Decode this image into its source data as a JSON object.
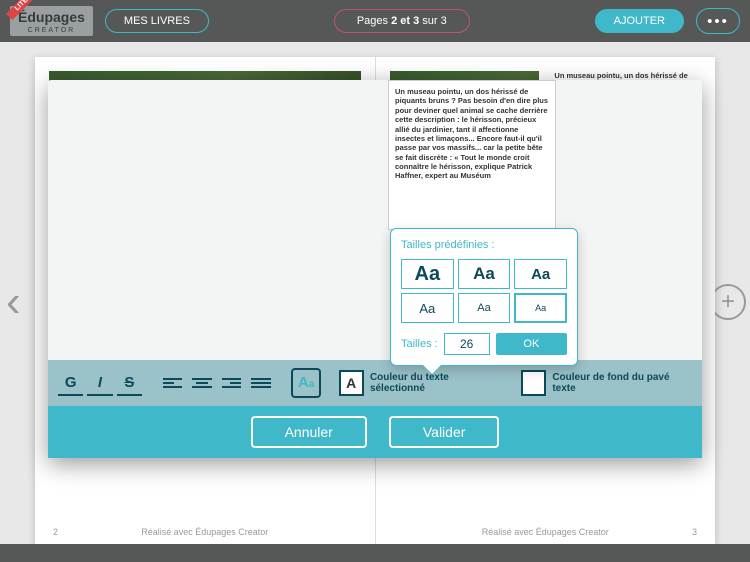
{
  "app": {
    "logo_main": "Édupages",
    "logo_sub": "CREATOR",
    "lite": "LITE"
  },
  "topbar": {
    "mes_livres": "MES LIVRES",
    "page_prefix": "Pages ",
    "page_current": "2 et 3",
    "page_suffix": " sur 3",
    "ajouter": "AJOUTER",
    "more": "•••"
  },
  "book": {
    "footer": "Réalisé avec Édupages Creator",
    "page_left_num": "2",
    "page_right_num": "3",
    "right_text": "Un museau pointu, un dos hérissé de piquants bruns ? Pas besoin de"
  },
  "modal": {
    "preview_text": "Un museau pointu, un dos hérissé de piquants bruns ? Pas besoin d'en dire plus pour deviner quel animal se cache derrière cette description : le hérisson, précieux allié du jardinier, tant il affectionne insectes et limaçons... Encore faut-il qu'il passe par vos massifs... car la petite bête se fait discrète : « Tout le monde croit connaître le hérisson, explique Patrick Haffner, expert au Muséum",
    "cancel": "Annuler",
    "validate": "Valider"
  },
  "toolbar": {
    "bold": "G",
    "italic": "I",
    "strike": "S",
    "color_text_label": "Couleur du texte sélectionné",
    "color_bg_label": "Couleur de fond du pavé texte",
    "letter": "A"
  },
  "popover": {
    "title": "Tailles prédéfinies :",
    "sizes": [
      "Aa",
      "Aa",
      "Aa",
      "Aa",
      "Aa",
      "Aa"
    ],
    "size_label": "Tailles :",
    "size_value": "26",
    "ok": "OK"
  }
}
